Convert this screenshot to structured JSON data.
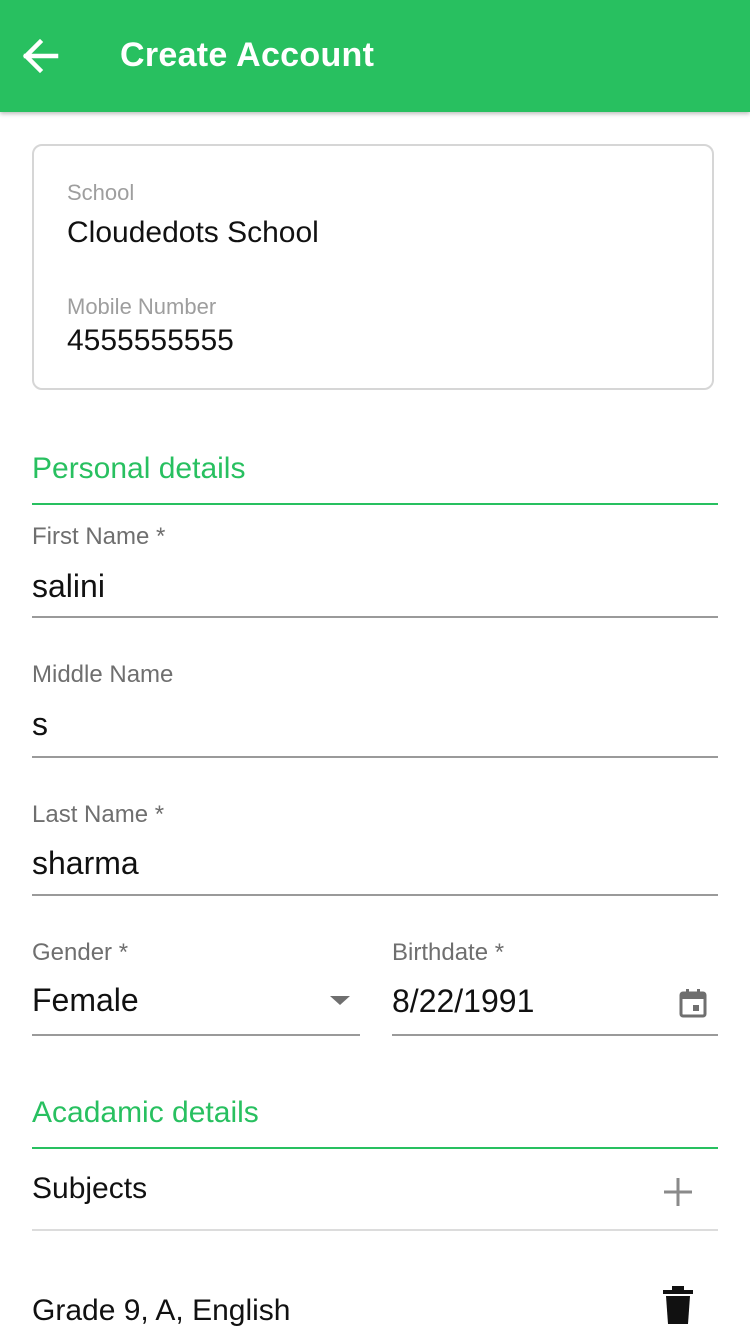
{
  "appbar": {
    "title": "Create Account",
    "back_icon": "arrow-left-icon",
    "background": "#28c060"
  },
  "info_card": {
    "school_label": "School",
    "school_value": "Cloudedots School",
    "mobile_label": "Mobile Number",
    "mobile_value": "4555555555"
  },
  "personal_section": {
    "title": "Personal details",
    "first_name": {
      "label": "First Name *",
      "value": "salini"
    },
    "middle_name": {
      "label": "Middle Name",
      "value": "s"
    },
    "last_name": {
      "label": "Last Name *",
      "value": "sharma"
    },
    "gender": {
      "label": "Gender *",
      "value": "Female",
      "icon": "dropdown-arrow-icon"
    },
    "birthdate": {
      "label": "Birthdate *",
      "value": "8/22/1991",
      "icon": "calendar-icon"
    }
  },
  "academic_section": {
    "title": "Acadamic details",
    "subjects_label": "Subjects",
    "add_icon": "plus-icon",
    "subject_items": [
      {
        "text": "Grade 9, A, English",
        "delete_icon": "trash-icon"
      }
    ]
  },
  "colors": {
    "accent": "#28c060",
    "label_gray": "#6f6f6f",
    "underline_gray": "#9a9a9a"
  }
}
